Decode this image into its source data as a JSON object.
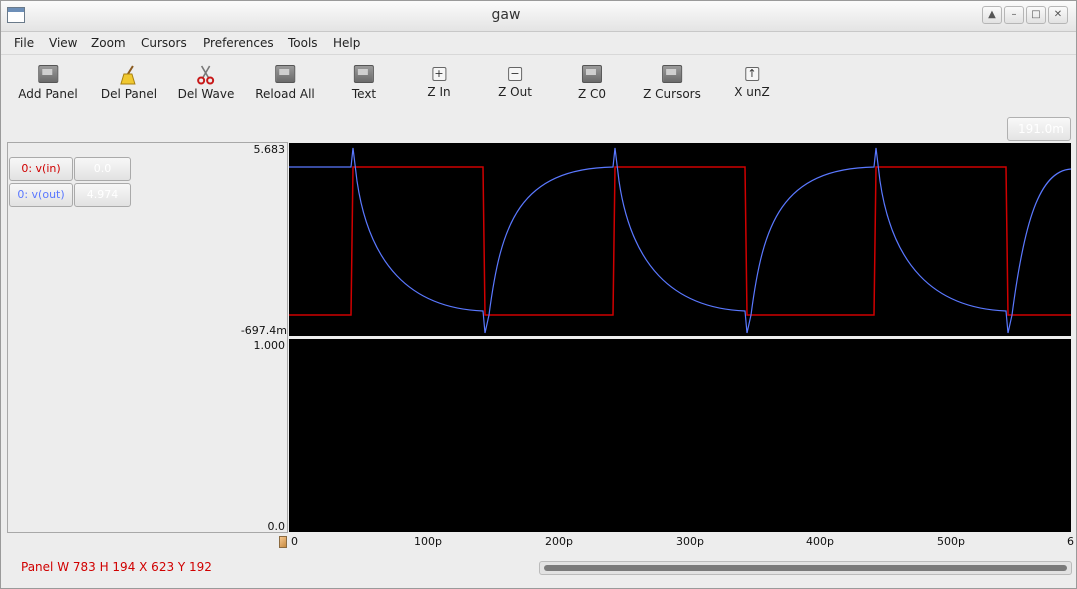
{
  "window": {
    "title": "gaw"
  },
  "menu": [
    "File",
    "View",
    "Zoom",
    "Cursors",
    "Preferences",
    "Tools",
    "Help"
  ],
  "toolbar": [
    {
      "label": "Add Panel",
      "icon": "add-panel-icon"
    },
    {
      "label": "Del Panel",
      "icon": "broom-icon"
    },
    {
      "label": "Del Wave",
      "icon": "scissors-icon"
    },
    {
      "label": "Reload All",
      "icon": "reload-icon"
    },
    {
      "label": "Text",
      "icon": "text-icon"
    },
    {
      "label": "Z In",
      "icon": "zoom-in-icon"
    },
    {
      "label": "Z Out",
      "icon": "zoom-out-icon"
    },
    {
      "label": "Z C0",
      "icon": "zoom-cursor0-icon"
    },
    {
      "label": "Z Cursors",
      "icon": "zoom-cursors-icon"
    },
    {
      "label": "X unZ",
      "icon": "x-unzoom-icon"
    }
  ],
  "x_position": "191.0m",
  "panels": [
    {
      "ymax": "5.683",
      "ymin": "-697.4m",
      "waves": [
        {
          "name": "0: v(in)",
          "value": "0.0",
          "color": "#d00000"
        },
        {
          "name": "0: v(out)",
          "value": "4.974",
          "color": "#5a78ff"
        }
      ]
    },
    {
      "ymax": "1.000",
      "ymin": "0.0",
      "waves": []
    }
  ],
  "xaxis": {
    "ticks": [
      "0",
      "100p",
      "200p",
      "300p",
      "400p",
      "500p",
      "6"
    ]
  },
  "status": "Panel W 783 H 194 X 623 Y 192"
}
